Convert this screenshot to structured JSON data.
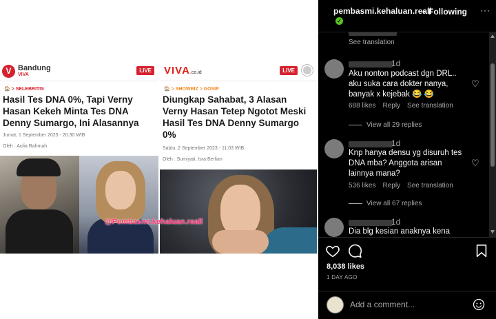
{
  "post": {
    "article_left": {
      "brand": "Bandung",
      "brand_sub": "VIVA",
      "live": "LIVE",
      "breadcrumb": "🏠 > SELEBRITIS",
      "headline": "Hasil Tes DNA 0%, Tapi Verny Hasan Kekeh Minta Tes DNA Denny Sumargo, Ini Alasannya",
      "date": "Jumat, 1 September 2023 - 20:30 WIB",
      "author": "Oleh :   Aulia Rahmah"
    },
    "article_right": {
      "brand": "VIVA",
      "brand_tld": ".co.id",
      "live": "LIVE",
      "breadcrumb": "🏠 > SHOWBIZ > GOSIP",
      "headline": "Diungkap Sahabat, 3 Alasan Verny Hasan Tetep Ngotot Meski Hasil Tes DNA Denny Sumargo 0%",
      "date": "Sabtu, 2 September 2023 - 11:03 WIB",
      "author": "Oleh :   Sumiyati,  Isra Berlian"
    },
    "watermark": "@Pembasmi.kehaluan.reall"
  },
  "instagram": {
    "header": {
      "username": "pembasmi.kehaluan.reall",
      "dot": "•",
      "following": "Following",
      "more": "···"
    },
    "comments": [
      {
        "time": "",
        "text": "",
        "see_translation": "See translation"
      },
      {
        "time": "1d",
        "text": "Aku nonton podcast dgn DRL.. aku suka cara dokter nanya, banyak x kejebak 😂 😂",
        "likes": "688 likes",
        "reply": "Reply",
        "see_translation": "See translation",
        "view_replies": "View all 29 replies"
      },
      {
        "time": "1d",
        "text": "Knp hanya densu yg disuruh tes DNA mba? Anggota arisan lainnya mana?",
        "likes": "536 likes",
        "reply": "Reply",
        "see_translation": "See translation",
        "view_replies": "View all 67 replies"
      },
      {
        "time": "1d",
        "text": "Dia blg kesian anaknya kena"
      }
    ],
    "likes": "8,038 likes",
    "date": "1 DAY AGO",
    "comment_placeholder": "Add a comment..."
  }
}
